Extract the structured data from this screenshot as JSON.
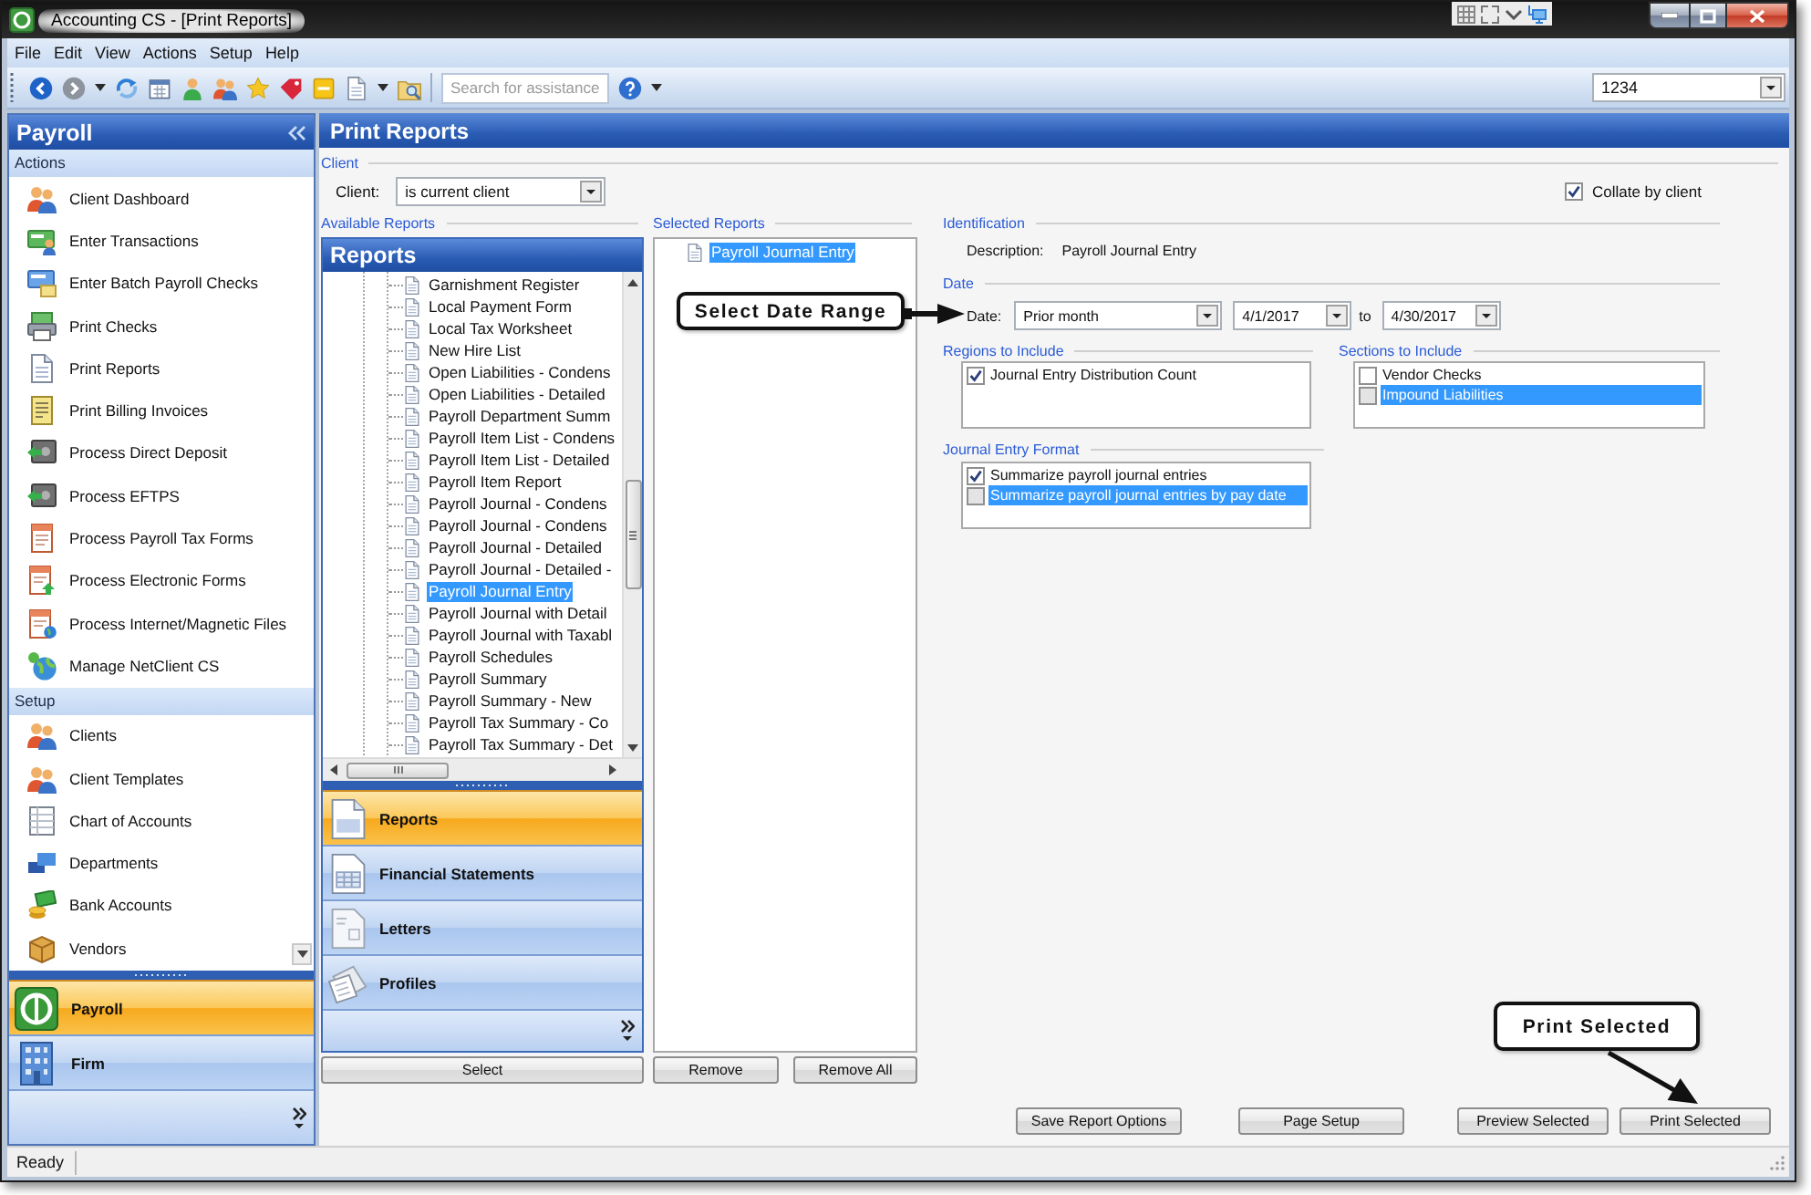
{
  "window": {
    "title": "Accounting CS - [Print Reports]"
  },
  "menu": [
    "File",
    "Edit",
    "View",
    "Actions",
    "Setup",
    "Help"
  ],
  "toolbar": {
    "search": {
      "placeholder": "Search for assistance"
    },
    "client_box": {
      "value": "1234"
    }
  },
  "sidebar": {
    "title": "Payroll",
    "sections": [
      {
        "title": "Actions",
        "items": [
          "Client Dashboard",
          "Enter Transactions",
          "Enter Batch Payroll Checks",
          "Print Checks",
          "Print Reports",
          "Print Billing Invoices",
          "Process Direct Deposit",
          "Process EFTPS",
          "Process Payroll Tax Forms",
          "Process Electronic Forms",
          "Process Internet/Magnetic Files",
          "Manage NetClient CS"
        ]
      },
      {
        "title": "Setup",
        "items": [
          "Clients",
          "Client Templates",
          "Chart of Accounts",
          "Departments",
          "Bank Accounts",
          "Vendors"
        ]
      }
    ],
    "nav": [
      {
        "label": "Payroll",
        "selected": true
      },
      {
        "label": "Firm",
        "selected": false
      }
    ]
  },
  "panel": {
    "title": "Print Reports",
    "client": {
      "title": "Client",
      "label": "Client:",
      "value": "is current client"
    },
    "collate": {
      "label": "Collate by client",
      "checked": true
    },
    "available_reports": {
      "title": "Available Reports",
      "header": "Reports",
      "items": [
        {
          "label": "Garnishment Register",
          "selected": false
        },
        {
          "label": "Local Payment Form",
          "selected": false
        },
        {
          "label": "Local Tax Worksheet",
          "selected": false
        },
        {
          "label": "New Hire List",
          "selected": false
        },
        {
          "label": "Open Liabilities - Condens",
          "selected": false
        },
        {
          "label": "Open Liabilities - Detailed",
          "selected": false
        },
        {
          "label": "Payroll Department Summ",
          "selected": false
        },
        {
          "label": "Payroll Item List - Condens",
          "selected": false
        },
        {
          "label": "Payroll Item List - Detailed",
          "selected": false
        },
        {
          "label": "Payroll Item Report",
          "selected": false
        },
        {
          "label": "Payroll Journal - Condens",
          "selected": false
        },
        {
          "label": "Payroll Journal - Condens",
          "selected": false
        },
        {
          "label": "Payroll Journal - Detailed",
          "selected": false
        },
        {
          "label": "Payroll Journal - Detailed -",
          "selected": false
        },
        {
          "label": "Payroll Journal Entry",
          "selected": true
        },
        {
          "label": "Payroll Journal with Detail",
          "selected": false
        },
        {
          "label": "Payroll Journal with Taxabl",
          "selected": false
        },
        {
          "label": "Payroll Schedules",
          "selected": false
        },
        {
          "label": "Payroll Summary",
          "selected": false
        },
        {
          "label": "Payroll Summary - New",
          "selected": false
        },
        {
          "label": "Payroll Tax Summary - Co",
          "selected": false
        },
        {
          "label": "Payroll Tax Summary - Det",
          "selected": false
        }
      ],
      "nav": [
        {
          "label": "Reports",
          "selected": true
        },
        {
          "label": "Financial Statements",
          "selected": false
        },
        {
          "label": "Letters",
          "selected": false
        },
        {
          "label": "Profiles",
          "selected": false
        }
      ],
      "button": "Select"
    },
    "selected_reports": {
      "title": "Selected Reports",
      "items": [
        {
          "label": "Payroll Journal Entry",
          "selected": true
        }
      ],
      "buttons": [
        "Remove",
        "Remove All"
      ]
    },
    "identification": {
      "title": "Identification",
      "label": "Description:",
      "value": "Payroll Journal Entry"
    },
    "date": {
      "title": "Date",
      "label": "Date:",
      "range": "Prior month",
      "from": "4/1/2017",
      "separator": "to",
      "to": "4/30/2017"
    },
    "regions": {
      "title": "Regions to Include",
      "items": [
        {
          "label": "Journal Entry Distribution Count",
          "checked": true,
          "selected": false
        }
      ]
    },
    "sections": {
      "title": "Sections to Include",
      "items": [
        {
          "label": "Vendor Checks",
          "checked": false,
          "selected": false
        },
        {
          "label": "Impound Liabilities",
          "checked": false,
          "selected": true
        }
      ]
    },
    "format": {
      "title": "Journal Entry Format",
      "items": [
        {
          "label": "Summarize payroll journal entries",
          "checked": true,
          "selected": false
        },
        {
          "label": "Summarize payroll journal entries by pay date",
          "checked": false,
          "selected": true
        }
      ]
    },
    "buttons": [
      "Save Report Options",
      "Page Setup",
      "Preview Selected",
      "Print Selected"
    ]
  },
  "callouts": [
    {
      "kind": "right",
      "text": "Select Date Range"
    },
    {
      "kind": "down",
      "text": "Print Selected"
    }
  ],
  "status_bar": {
    "text": "Ready"
  }
}
